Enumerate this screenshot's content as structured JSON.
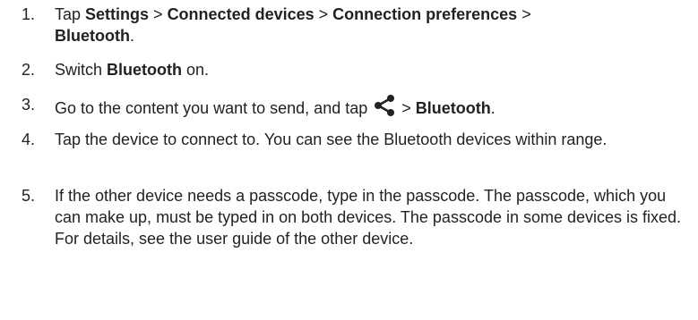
{
  "steps": [
    {
      "number": "1.",
      "parts": {
        "a": "Tap ",
        "b": "Settings",
        "c": " > ",
        "d": "Connected devices",
        "e": " > ",
        "f": "Connection preferences",
        "g": " > ",
        "h": "Bluetooth",
        "i": "."
      }
    },
    {
      "number": "2.",
      "parts": {
        "a": "Switch ",
        "b": "Bluetooth",
        "c": " on."
      }
    },
    {
      "number": "3.",
      "parts": {
        "a": "Go to the content you want to send, and tap ",
        "icon": "share-icon",
        "b": " > ",
        "c": "Bluetooth",
        "d": "."
      }
    },
    {
      "number": "4.",
      "text": "Tap the device to connect to. You can see the Bluetooth devices within range."
    },
    {
      "number": "5.",
      "text": "If the other device needs a passcode, type in the passcode. The passcode, which you can make up, must be typed in on both devices. The passcode in some devices is fixed. For details, see the user guide of the other device."
    }
  ],
  "colors": {
    "text": "#222222",
    "background": "#ffffff"
  }
}
